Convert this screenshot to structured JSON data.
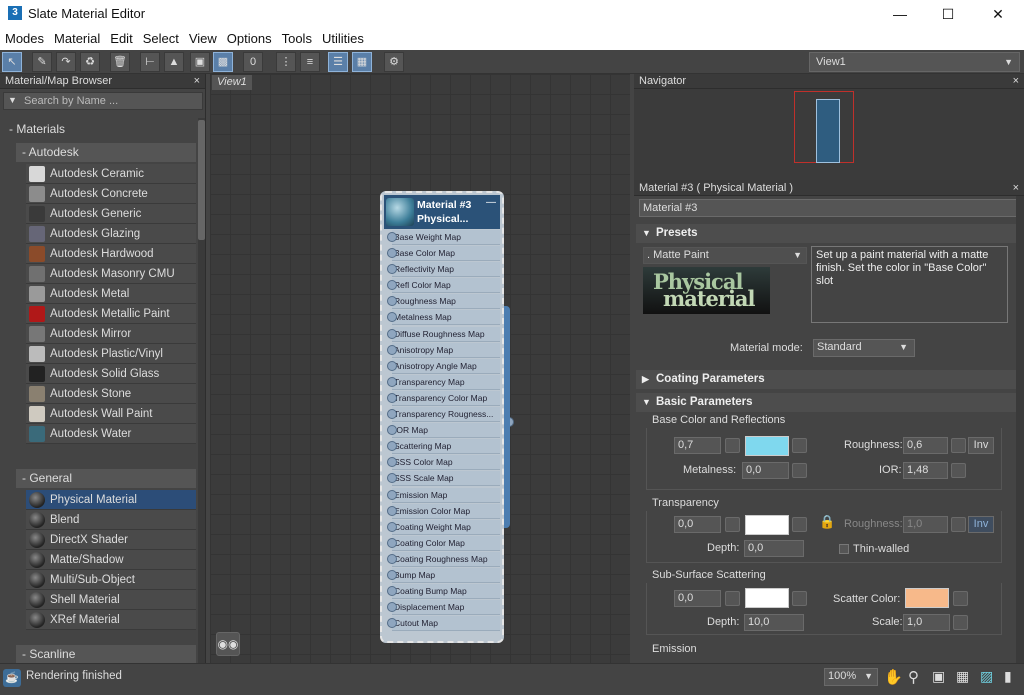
{
  "window": {
    "title": "Slate Material Editor",
    "app_icon": "3"
  },
  "menu": [
    "Modes",
    "Material",
    "Edit",
    "Select",
    "View",
    "Options",
    "Tools",
    "Utilities"
  ],
  "toolbar": {
    "view_select": "View1",
    "num_button": "0"
  },
  "browser": {
    "header": "Material/Map Browser",
    "search_placeholder": "Search by Name ...",
    "materials_label": "- Materials",
    "autodesk_label": "- Autodesk",
    "autodesk_items": [
      "Autodesk Ceramic",
      "Autodesk Concrete",
      "Autodesk Generic",
      "Autodesk Glazing",
      "Autodesk Hardwood",
      "Autodesk Masonry CMU",
      "Autodesk Metal",
      "Autodesk Metallic Paint",
      "Autodesk Mirror",
      "Autodesk Plastic/Vinyl",
      "Autodesk Solid Glass",
      "Autodesk Stone",
      "Autodesk Wall Paint",
      "Autodesk Water"
    ],
    "general_label": "- General",
    "general_items": [
      "Physical Material",
      "Blend",
      "DirectX Shader",
      "Matte/Shadow",
      "Multi/Sub-Object",
      "Shell Material",
      "XRef Material"
    ],
    "scanline_label": "- Scanline"
  },
  "view": {
    "tab": "View1"
  },
  "node": {
    "title1": "Material #3",
    "title2": "Physical...",
    "slots": [
      "Base Weight Map",
      "Base Color Map",
      "Reflectivity Map",
      "Refl Color Map",
      "Roughness Map",
      "Metalness Map",
      "Diffuse Roughness Map",
      "Anisotropy Map",
      "Anisotropy Angle Map",
      "Transparency Map",
      "Transparency Color Map",
      "Transparency Rougness...",
      "IOR Map",
      "Scattering Map",
      "SSS Color Map",
      "SSS Scale Map",
      "Emission Map",
      "Emission Color Map",
      "Coating Weight Map",
      "Coating Color Map",
      "Coating Roughness Map",
      "Bump Map",
      "Coating Bump Map",
      "Displacement Map",
      "Cutout Map"
    ]
  },
  "navigator": {
    "header": "Navigator"
  },
  "props": {
    "header": "Material #3  ( Physical Material )",
    "name_field": "Material #3",
    "presets_title": "Presets",
    "preset_value": ".    Matte Paint",
    "preset_desc": "Set up a paint material with a matte finish. Set the color in \"Base Color\" slot",
    "logo_line1": "Physical",
    "logo_line2": "material",
    "mode_label": "Material mode:",
    "mode_value": "Standard",
    "coating_title": "Coating Parameters",
    "basic_title": "Basic Parameters",
    "bcr_label": "Base Color and Reflections",
    "base_weight": "0,7",
    "roughness_label": "Roughness:",
    "roughness_value": "0,6",
    "inv": "Inv",
    "metalness_label": "Metalness:",
    "metalness_value": "0,0",
    "ior_label": "IOR:",
    "ior_value": "1,48",
    "transparency_label": "Transparency",
    "trans_weight": "0,0",
    "trans_roughness_label": "Roughness:",
    "trans_roughness_value": "1,0",
    "depth_label": "Depth:",
    "trans_depth": "0,0",
    "thin_walled": "Thin-walled",
    "sss_label": "Sub-Surface Scattering",
    "sss_weight": "0,0",
    "scatter_color_label": "Scatter Color:",
    "sss_depth": "10,0",
    "scale_label": "Scale:",
    "scale_value": "1,0",
    "emission_label": "Emission",
    "colors": {
      "base": "#7fd8ee",
      "scatter": "#f7b98a",
      "trans": "#ffffff",
      "sss": "#ffffff"
    }
  },
  "status": {
    "text": "Rendering finished",
    "zoom": "100%"
  }
}
